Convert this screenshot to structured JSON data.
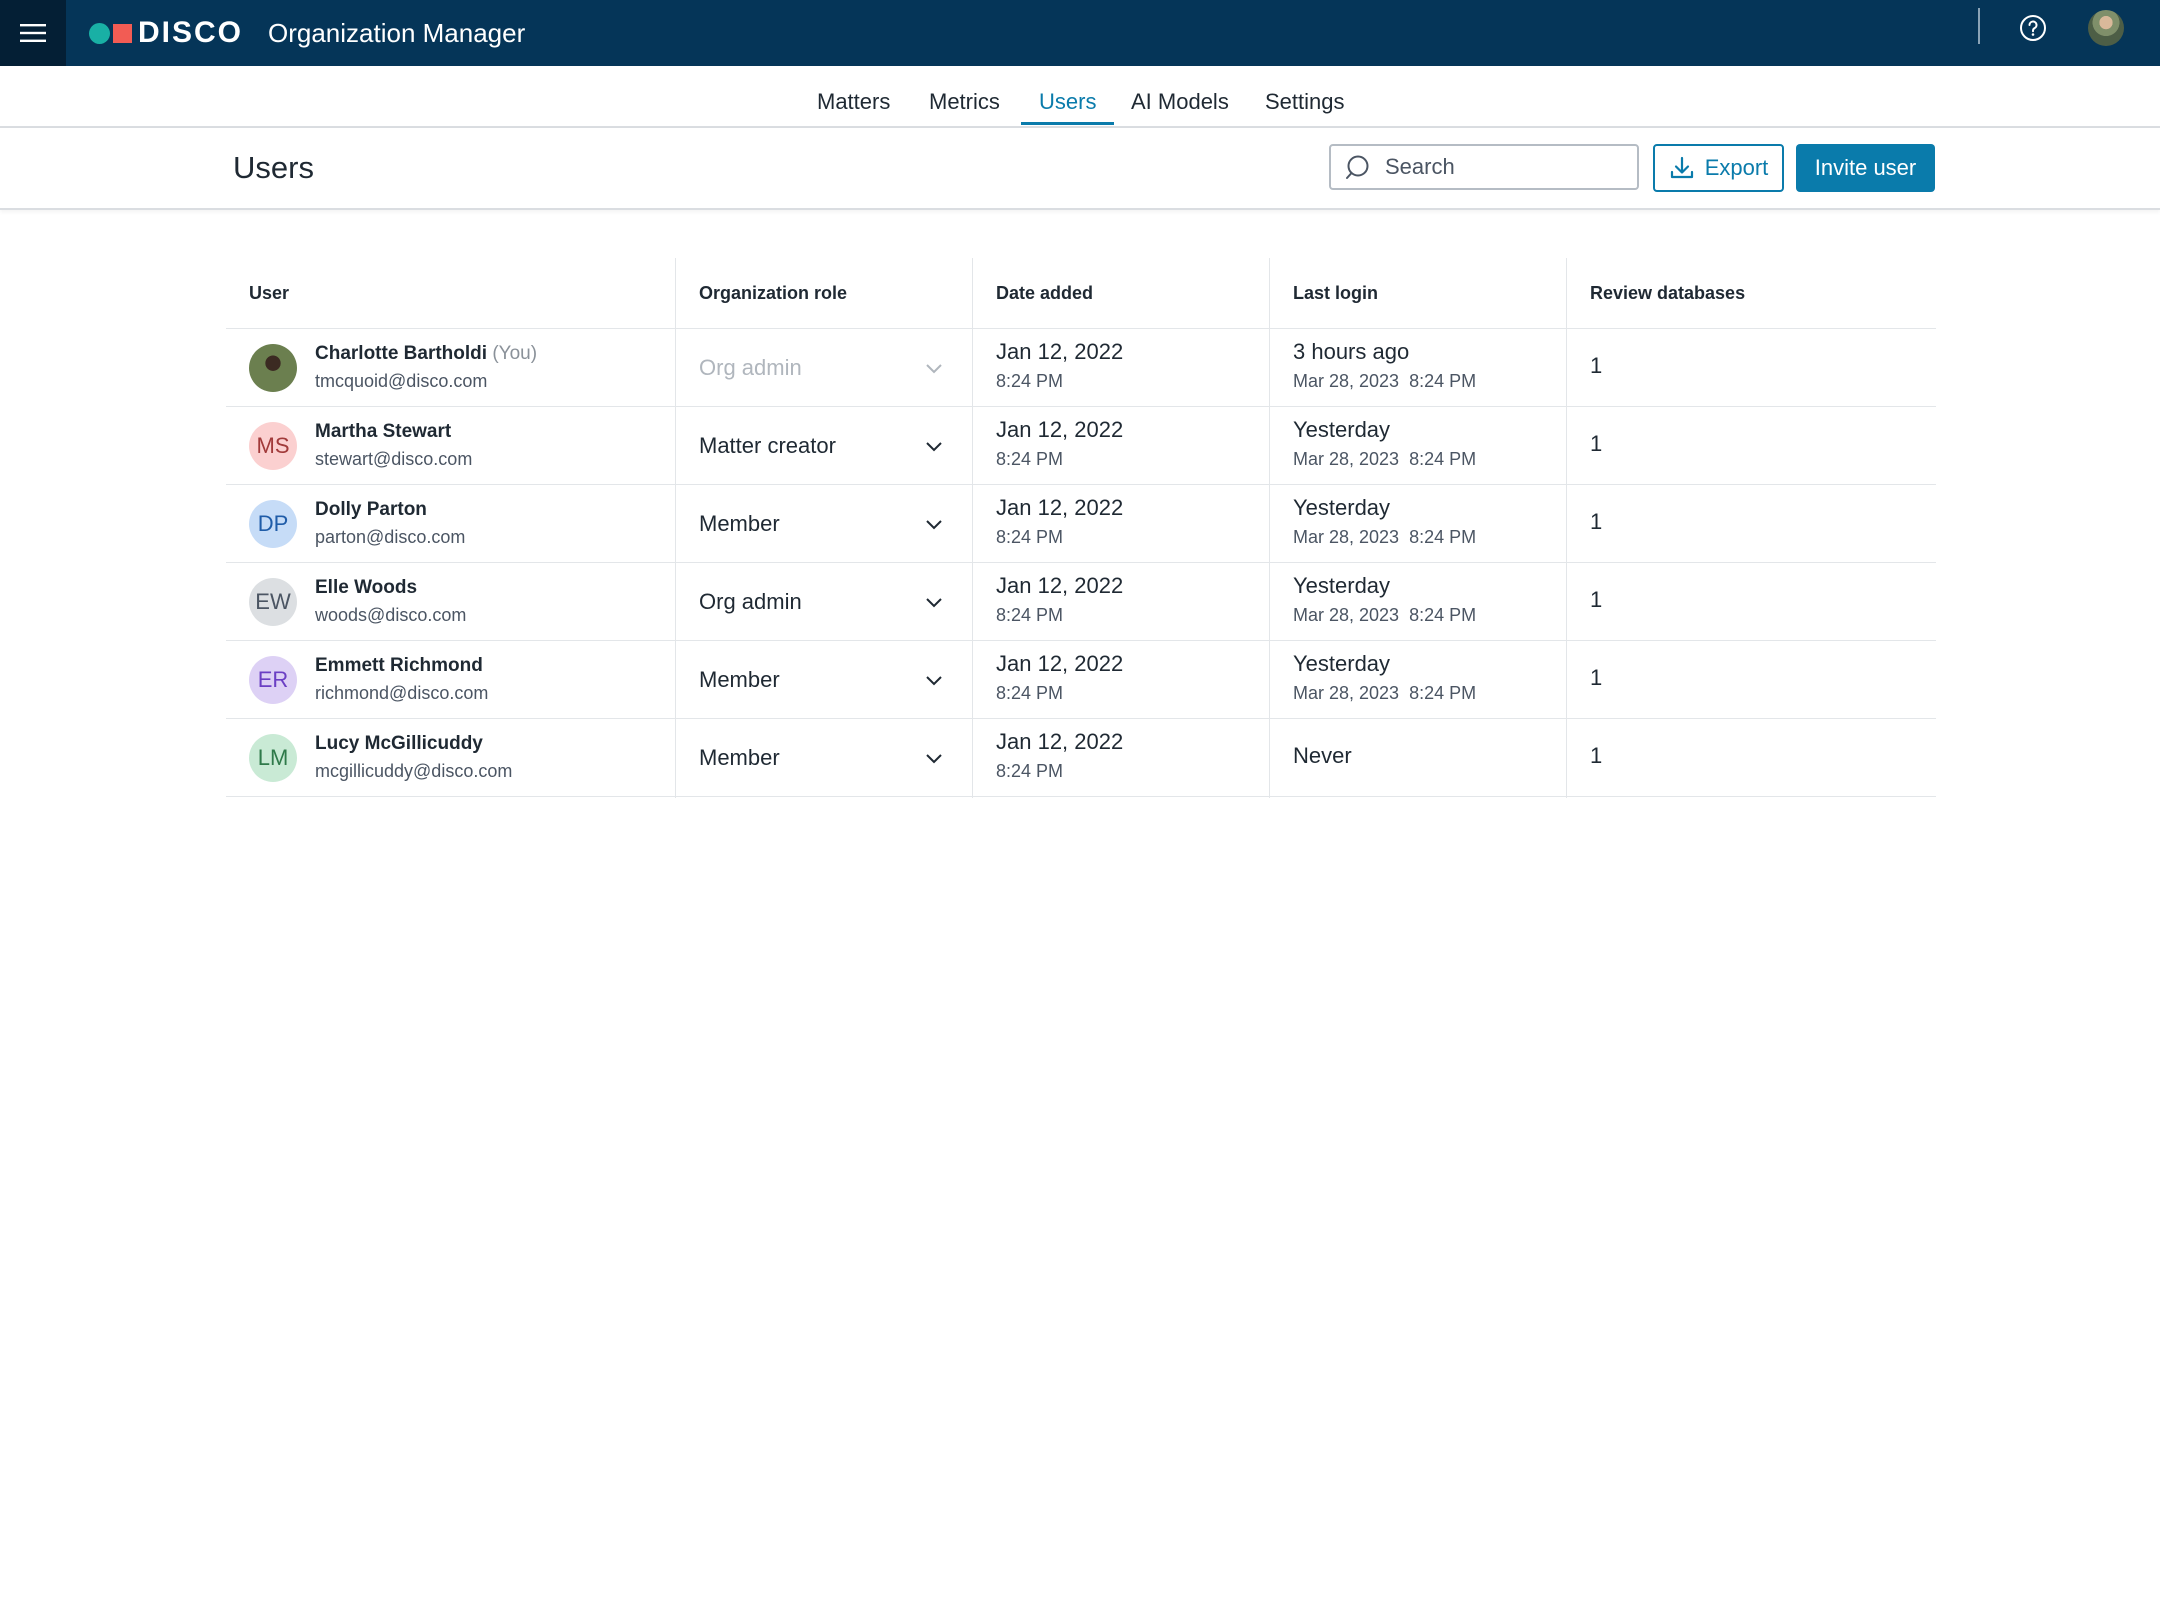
{
  "topbar": {
    "brand": "DISCO",
    "title": "Organization Manager",
    "menu_icon": "hamburger-menu-icon",
    "help_icon": "question-circle-icon",
    "colors": {
      "bar": "#053558",
      "menu_bg": "#041f35",
      "logo_dot": "#19b0a5",
      "logo_square": "#f25c54"
    }
  },
  "tabs": [
    {
      "label": "Matters",
      "active": false
    },
    {
      "label": "Metrics",
      "active": false
    },
    {
      "label": "Users",
      "active": true
    },
    {
      "label": "AI Models",
      "active": false
    },
    {
      "label": "Settings",
      "active": false
    }
  ],
  "page": {
    "title": "Users",
    "search_placeholder": "Search",
    "export_label": "Export",
    "invite_label": "Invite user",
    "accent": "#0a7bab"
  },
  "table": {
    "headers": {
      "user": "User",
      "role": "Organization role",
      "date_added": "Date added",
      "last_login": "Last login",
      "review_dbs": "Review databases"
    },
    "rows": [
      {
        "name": "Charlotte Bartholdi",
        "you": "(You)",
        "email": "tmcquoid@disco.com",
        "initials": "",
        "role": "Org admin",
        "role_disabled": true,
        "date_added": "Jan 12, 2022",
        "time_added": "8:24 PM",
        "last_login": "3 hours ago",
        "last_login_detail": "Mar 28, 2023  8:24 PM",
        "review_databases": "1"
      },
      {
        "name": "Martha Stewart",
        "you": "",
        "email": "stewart@disco.com",
        "initials": "MS",
        "avatar_bg": "#fbd0d0",
        "avatar_fg": "#a13a3a",
        "role": "Matter creator",
        "role_disabled": false,
        "date_added": "Jan 12, 2022",
        "time_added": "8:24 PM",
        "last_login": "Yesterday",
        "last_login_detail": "Mar 28, 2023  8:24 PM",
        "review_databases": "1"
      },
      {
        "name": "Dolly Parton",
        "you": "",
        "email": "parton@disco.com",
        "initials": "DP",
        "avatar_bg": "#c6dcf7",
        "avatar_fg": "#1f5ca8",
        "role": "Member",
        "role_disabled": false,
        "date_added": "Jan 12, 2022",
        "time_added": "8:24 PM",
        "last_login": "Yesterday",
        "last_login_detail": "Mar 28, 2023  8:24 PM",
        "review_databases": "1"
      },
      {
        "name": "Elle Woods",
        "you": "",
        "email": "woods@disco.com",
        "initials": "EW",
        "avatar_bg": "#dcdfe2",
        "avatar_fg": "#4b5563",
        "role": "Org admin",
        "role_disabled": false,
        "date_added": "Jan 12, 2022",
        "time_added": "8:24 PM",
        "last_login": "Yesterday",
        "last_login_detail": "Mar 28, 2023  8:24 PM",
        "review_databases": "1"
      },
      {
        "name": "Emmett Richmond",
        "you": "",
        "email": "richmond@disco.com",
        "initials": "ER",
        "avatar_bg": "#ddd1f5",
        "avatar_fg": "#6b3fc4",
        "role": "Member",
        "role_disabled": false,
        "date_added": "Jan 12, 2022",
        "time_added": "8:24 PM",
        "last_login": "Yesterday",
        "last_login_detail": "Mar 28, 2023  8:24 PM",
        "review_databases": "1"
      },
      {
        "name": "Lucy McGillicuddy",
        "you": "",
        "email": "mcgillicuddy@disco.com",
        "initials": "LM",
        "avatar_bg": "#c9ead5",
        "avatar_fg": "#2f7a4a",
        "role": "Member",
        "role_disabled": false,
        "date_added": "Jan 12, 2022",
        "time_added": "8:24 PM",
        "last_login": "Never",
        "last_login_detail": "",
        "review_databases": "1"
      }
    ]
  }
}
